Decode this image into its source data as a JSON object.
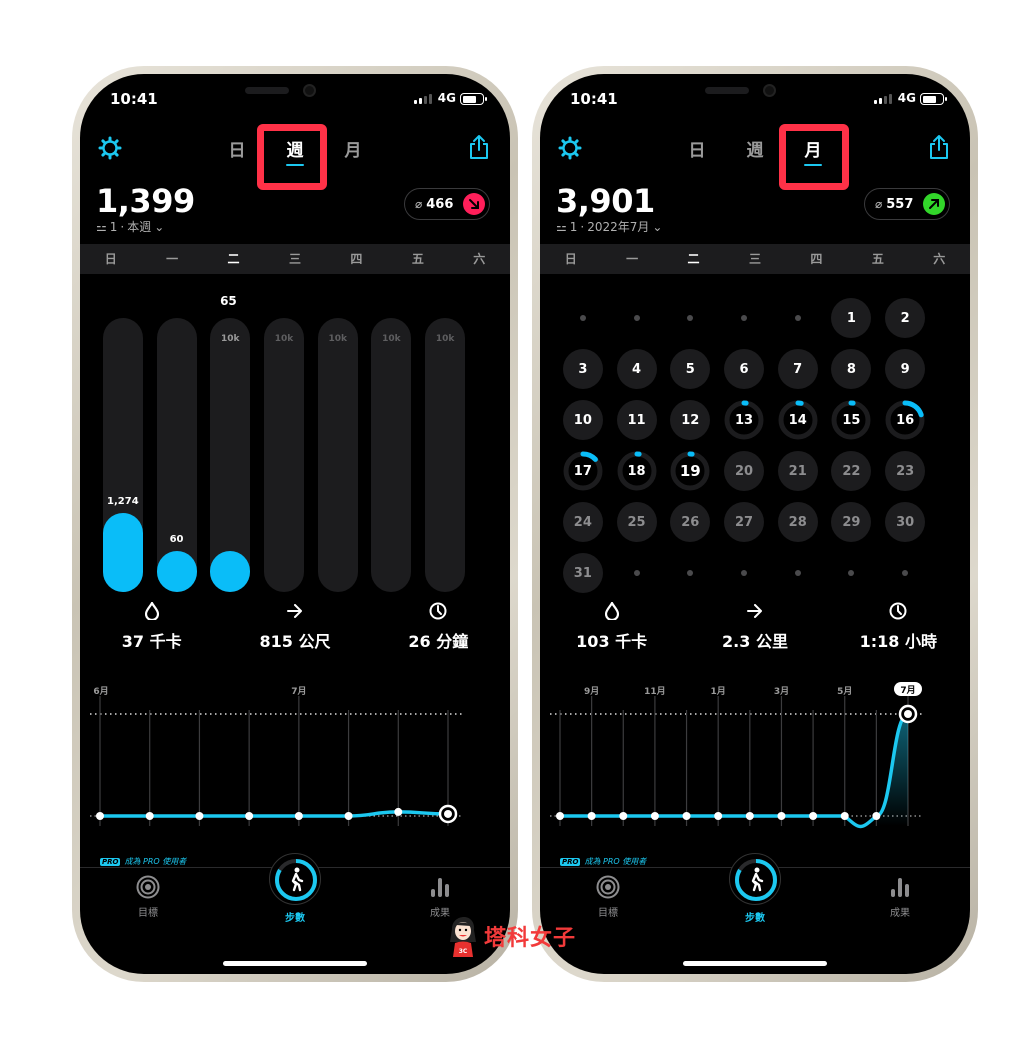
{
  "phones": [
    {
      "status": {
        "time": "10:41",
        "network": "4G"
      },
      "tabs": [
        {
          "label": "日"
        },
        {
          "label": "週",
          "active": true
        },
        {
          "label": "月"
        }
      ],
      "summary": {
        "total": "1,399",
        "rank": "1",
        "period": "本週",
        "average": "466",
        "trend": "down",
        "trend_color": "#ff1f5a"
      },
      "weekdays": [
        "日",
        "一",
        "二",
        "三",
        "四",
        "五",
        "六"
      ],
      "current_weekday_index": 2,
      "bars": {
        "goal_label": "10k",
        "current_day_label": "65",
        "days": [
          {
            "day": "日",
            "value": 1274,
            "label": "1,274",
            "fill_fraction": 0.29
          },
          {
            "day": "一",
            "value": 60,
            "label": "60",
            "fill_fraction": 0.15
          },
          {
            "day": "二",
            "value": 65,
            "label": "",
            "fill_fraction": 0.15
          },
          {
            "day": "三",
            "value": 0,
            "label": "",
            "fill_fraction": 0
          },
          {
            "day": "四",
            "value": 0,
            "label": "",
            "fill_fraction": 0
          },
          {
            "day": "五",
            "value": 0,
            "label": "",
            "fill_fraction": 0
          },
          {
            "day": "六",
            "value": 0,
            "label": "",
            "fill_fraction": 0
          }
        ]
      },
      "stats": [
        {
          "icon": "flame-icon",
          "value": "37 千卡"
        },
        {
          "icon": "arrow-right-icon",
          "value": "815 公尺"
        },
        {
          "icon": "clock-icon",
          "value": "26 分鐘"
        }
      ],
      "trend_chart": {
        "month_labels": [
          {
            "label": "6月",
            "index": 0
          },
          {
            "label": "7月",
            "index": 4
          }
        ],
        "values": [
          0,
          0,
          0,
          0,
          0,
          0,
          0.04,
          0.02
        ],
        "highlight_last": true
      },
      "pro_banner": {
        "tag": "PRO",
        "text": "成為 PRO 使用者"
      },
      "nav": [
        {
          "label": "目標",
          "icon": "target-icon"
        },
        {
          "label": "步數",
          "icon": "walk-icon",
          "active": true
        },
        {
          "label": "成果",
          "icon": "bar-chart-icon"
        }
      ]
    },
    {
      "status": {
        "time": "10:41",
        "network": "4G"
      },
      "tabs": [
        {
          "label": "日"
        },
        {
          "label": "週"
        },
        {
          "label": "月",
          "active": true
        }
      ],
      "summary": {
        "total": "3,901",
        "rank": "1",
        "period": "2022年7月",
        "average": "557",
        "trend": "up",
        "trend_color": "#32d62a"
      },
      "weekdays": [
        "日",
        "一",
        "二",
        "三",
        "四",
        "五",
        "六"
      ],
      "current_weekday_index": 2,
      "calendar": {
        "leading_blanks": 5,
        "days_in_month": 31,
        "today": 19,
        "progress": {
          "13": 0.02,
          "14": 0.03,
          "15": 0.02,
          "16": 0.2,
          "17": 0.13,
          "18": 0.02,
          "19": 0.02
        },
        "ringed_days": [
          13,
          14,
          15,
          16,
          17,
          18,
          19
        ]
      },
      "stats": [
        {
          "icon": "flame-icon",
          "value": "103 千卡"
        },
        {
          "icon": "arrow-right-icon",
          "value": "2.3 公里"
        },
        {
          "icon": "clock-icon",
          "value": "1:18 小時"
        }
      ],
      "trend_chart": {
        "month_labels": [
          {
            "label": "9月",
            "index": 1
          },
          {
            "label": "11月",
            "index": 3
          },
          {
            "label": "1月",
            "index": 5
          },
          {
            "label": "3月",
            "index": 7
          },
          {
            "label": "5月",
            "index": 9
          },
          {
            "label": "7月",
            "index": 11,
            "badge": true
          }
        ],
        "values": [
          0,
          0,
          0,
          0,
          0,
          0,
          0,
          0,
          0,
          0,
          0,
          1
        ],
        "highlight_last": true
      },
      "pro_banner": {
        "tag": "PRO",
        "text": "成為 PRO 使用者"
      },
      "nav": [
        {
          "label": "目標",
          "icon": "target-icon"
        },
        {
          "label": "步數",
          "icon": "walk-icon",
          "active": true
        },
        {
          "label": "成果",
          "icon": "bar-chart-icon"
        }
      ]
    }
  ],
  "watermark": {
    "text": "塔科女子",
    "badge": "3C"
  },
  "colors": {
    "accent": "#1cc8f0",
    "bar_fill": "#0abdf8",
    "highlight_box": "#ff3147",
    "track": "#1c1c1e"
  }
}
